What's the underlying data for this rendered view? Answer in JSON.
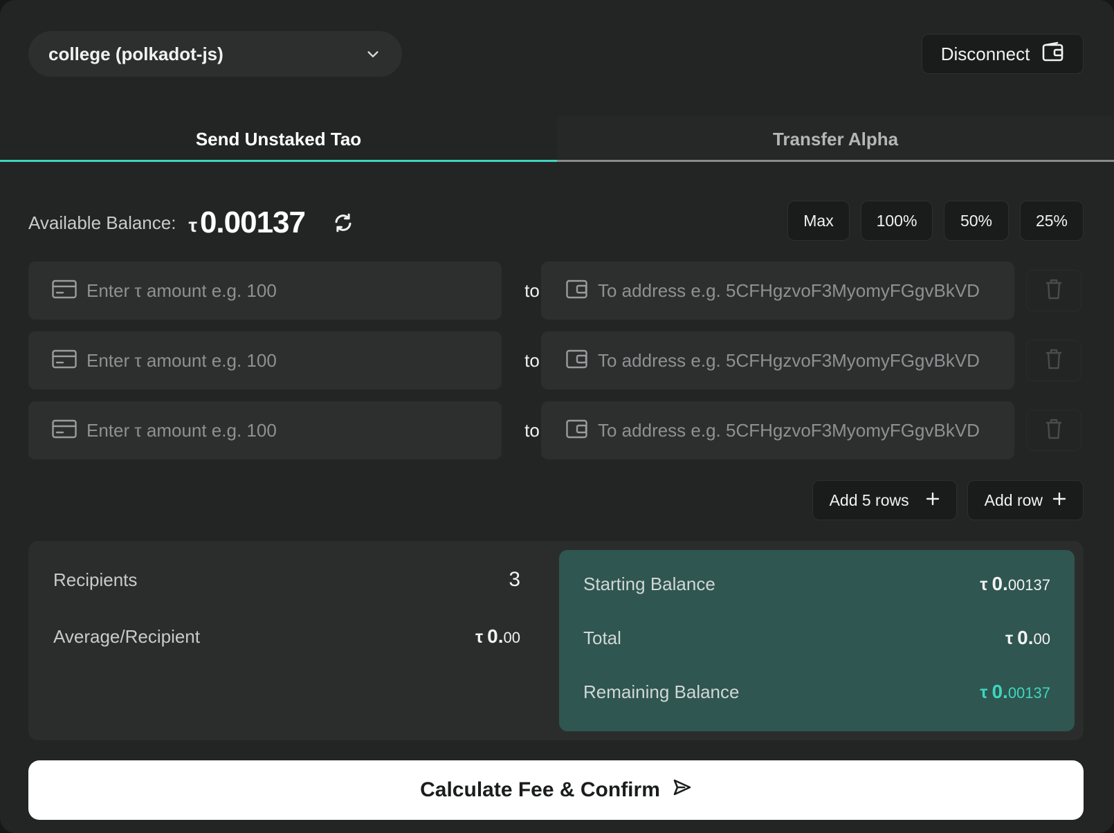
{
  "wallet": {
    "selected": "college (polkadot-js)"
  },
  "header": {
    "disconnect_label": "Disconnect"
  },
  "tabs": [
    {
      "label": "Send Unstaked Tao",
      "active": true
    },
    {
      "label": "Transfer Alpha",
      "active": false
    }
  ],
  "balance": {
    "label": "Available Balance:",
    "symbol": "τ",
    "value": "0.00137"
  },
  "percent_buttons": [
    "Max",
    "100%",
    "50%",
    "25%"
  ],
  "rows": [
    {
      "amount_placeholder": "Enter τ amount e.g. 100",
      "to": "to",
      "address_placeholder": "To address e.g. 5CFHgzvoF3MyomyFGgvBkVD"
    },
    {
      "amount_placeholder": "Enter τ amount e.g. 100",
      "to": "to",
      "address_placeholder": "To address e.g. 5CFHgzvoF3MyomyFGgvBkVD"
    },
    {
      "amount_placeholder": "Enter τ amount e.g. 100",
      "to": "to",
      "address_placeholder": "To address e.g. 5CFHgzvoF3MyomyFGgvBkVD"
    }
  ],
  "add_buttons": {
    "add_five": "Add 5 rows",
    "add_one": "Add row"
  },
  "summary": {
    "recipients_label": "Recipients",
    "recipients_value": "3",
    "average_label": "Average/Recipient",
    "average_symbol": "τ",
    "average_int": "0.",
    "average_dec": "00",
    "starting_label": "Starting Balance",
    "starting_symbol": "τ",
    "starting_int": "0.",
    "starting_dec": "00137",
    "total_label": "Total",
    "total_symbol": "τ",
    "total_int": "0.",
    "total_dec": "00",
    "remaining_label": "Remaining Balance",
    "remaining_symbol": "τ",
    "remaining_int": "0.",
    "remaining_dec": "00137"
  },
  "confirm": {
    "label": "Calculate Fee & Confirm"
  },
  "colors": {
    "accent": "#3ed6c0",
    "panel_green": "#2f5650",
    "background": "#232525"
  },
  "icons": [
    "chevron-down-icon",
    "wallet-icon",
    "refresh-icon",
    "card-icon",
    "trash-icon",
    "plus-icon",
    "send-icon"
  ]
}
